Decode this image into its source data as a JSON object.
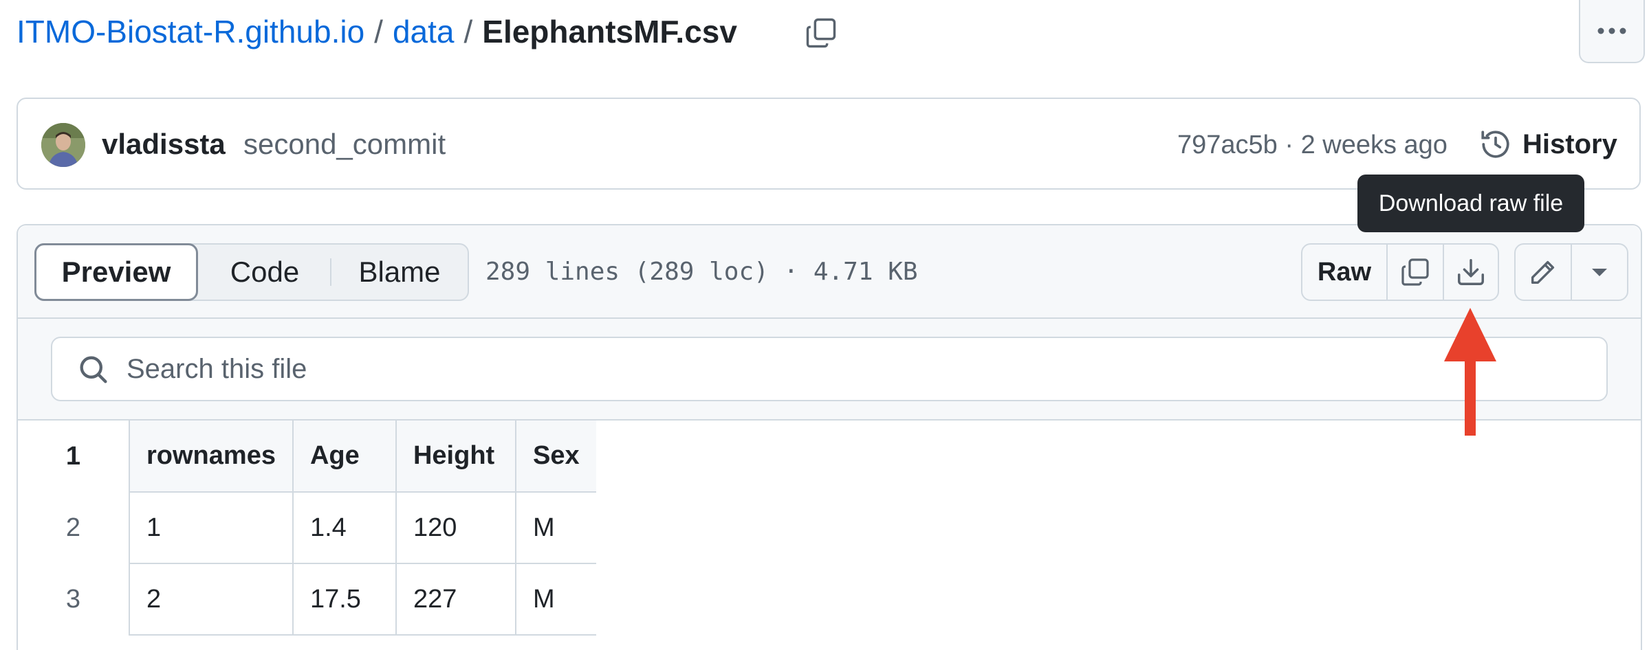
{
  "breadcrumb": {
    "repo": "ITMO-Biostat-R.github.io",
    "separator": "/",
    "folder": "data",
    "file": "ElephantsMF.csv",
    "copy_icon": "copy-icon"
  },
  "more_menu_icon": "kebab-horizontal-icon",
  "commit": {
    "author": "vladissta",
    "message": "second_commit",
    "meta": "797ac5b · 2 weeks ago",
    "history_label": "History"
  },
  "tooltip": "Download raw file",
  "view_tabs": [
    "Preview",
    "Code",
    "Blame"
  ],
  "file_info": "289 lines (289 loc) · 4.71 KB",
  "toolbar": {
    "raw_label": "Raw",
    "copy_icon": "copy-icon",
    "download_icon": "download-icon",
    "edit_icon": "pencil-icon",
    "more_icon": "triangle-down-icon"
  },
  "search": {
    "placeholder": "Search this file"
  },
  "table": {
    "line_numbers": [
      "1",
      "2",
      "3"
    ],
    "rows": [
      [
        "rownames",
        "Age",
        "Height",
        "Sex"
      ],
      [
        "1",
        "1.4",
        "120",
        "M"
      ],
      [
        "2",
        "17.5",
        "227",
        "M"
      ]
    ]
  },
  "colors": {
    "link": "#0969da",
    "border": "#d1d9e0",
    "tooltip_bg": "#25292e",
    "arrow": "#e8412c"
  }
}
